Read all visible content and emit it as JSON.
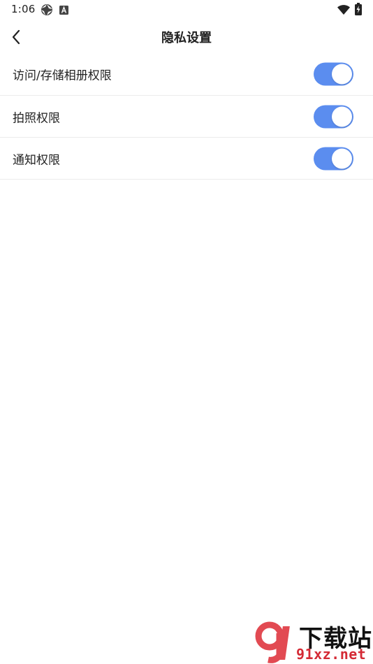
{
  "status_bar": {
    "time": "1:06",
    "icons": [
      "aperture-icon",
      "a-badge-icon",
      "wifi-icon",
      "battery-charging-icon"
    ]
  },
  "header": {
    "title": "隐私设置",
    "back_icon": "chevron-left-icon"
  },
  "settings": [
    {
      "label": "访问/存储相册权限",
      "enabled": true
    },
    {
      "label": "拍照权限",
      "enabled": true
    },
    {
      "label": "通知权限",
      "enabled": true
    }
  ],
  "colors": {
    "toggle_on": "#5b8def",
    "divider": "#ececec",
    "watermark_red": "#d42a35"
  },
  "watermark": {
    "top_text": "下载站",
    "bottom_text": "91xz.net"
  }
}
